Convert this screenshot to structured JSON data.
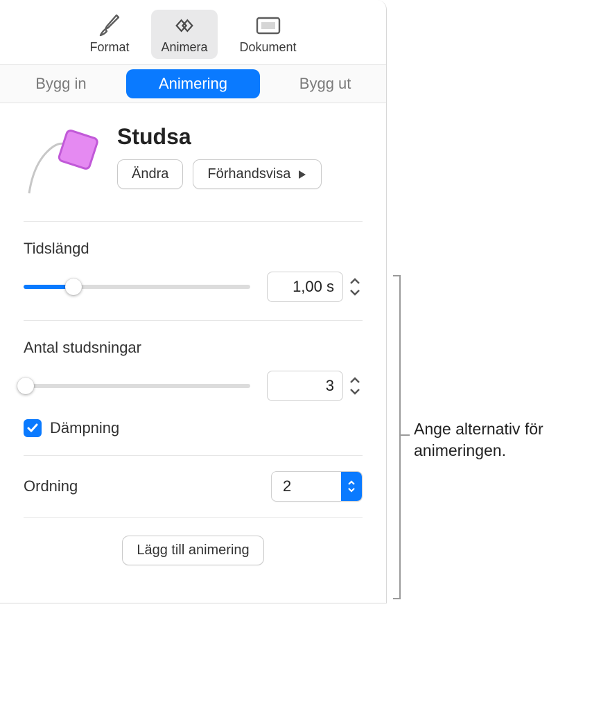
{
  "toolbar": {
    "format": "Format",
    "animate": "Animera",
    "document": "Dokument"
  },
  "tabs": {
    "build_in": "Bygg in",
    "action": "Animering",
    "build_out": "Bygg ut"
  },
  "animation": {
    "title": "Studsa",
    "change_label": "Ändra",
    "preview_label": "Förhandsvisa"
  },
  "duration": {
    "label": "Tidslängd",
    "value": "1,00 s",
    "slider_percent": 22
  },
  "bounces": {
    "label": "Antal studsningar",
    "value": "3",
    "slider_percent": 1,
    "damp_label": "Dämpning",
    "damp_checked": true
  },
  "order": {
    "label": "Ordning",
    "value": "2"
  },
  "add_animation_label": "Lägg till animering",
  "callout_text": "Ange alternativ för animeringen."
}
